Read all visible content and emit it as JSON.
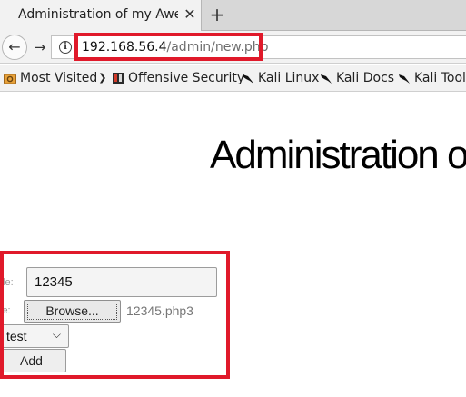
{
  "browser": {
    "tab": {
      "title": "Administration of my Awe…"
    },
    "url": {
      "host": "192.168.56.4",
      "path": "/admin/new.php"
    },
    "bookmarks": [
      {
        "label": "Most Visited",
        "icon": "gear-folder-icon",
        "has_dropdown": true
      },
      {
        "label": "Offensive Security",
        "icon": "offsec-icon"
      },
      {
        "label": "Kali Linux",
        "icon": "kali-dragon-icon"
      },
      {
        "label": "Kali Docs",
        "icon": "kali-dragon-icon"
      },
      {
        "label": "Kali Tool",
        "icon": "kali-dragon-icon"
      }
    ]
  },
  "page": {
    "heading": "Administration o",
    "form": {
      "title_label": "tle:",
      "title_value": "12345",
      "file_label": "le:",
      "browse_label": "Browse...",
      "chosen_file": "12345.php3",
      "category_selected": "test",
      "add_label": "Add"
    }
  },
  "colors": {
    "annotation_red": "#e0192a",
    "chrome_bg": "#f2f2f2"
  }
}
